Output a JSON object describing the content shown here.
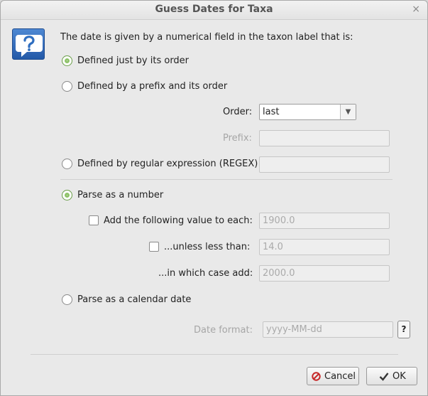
{
  "window": {
    "title": "Guess Dates for Taxa",
    "close_glyph": "×"
  },
  "description": "The date is given by a numerical field in the taxon label that is:",
  "options": {
    "order": "Defined just by its order",
    "prefix_order": "Defined by a prefix and its order",
    "regex": "Defined by regular expression (REGEX)"
  },
  "order_field": {
    "label": "Order:",
    "value": "last"
  },
  "prefix_field": {
    "label": "Prefix:",
    "value": ""
  },
  "regex_field": {
    "value": ""
  },
  "parse": {
    "number": "Parse as a number",
    "add_value": {
      "label": "Add the following value to each:",
      "value": "1900.0"
    },
    "unless": {
      "label": "...unless less than:",
      "value": "14.0"
    },
    "in_which": {
      "label": "...in which case add:",
      "value": "2000.0"
    },
    "calendar": "Parse as a calendar date",
    "date_format": {
      "label": "Date format:",
      "value": "yyyy-MM-dd",
      "help": "?"
    }
  },
  "buttons": {
    "cancel": "Cancel",
    "ok": "OK"
  },
  "colors": {
    "radio_selected": "#8fc36a",
    "icon_blue": "#2f6ec0",
    "cancel_red": "#c62828"
  }
}
